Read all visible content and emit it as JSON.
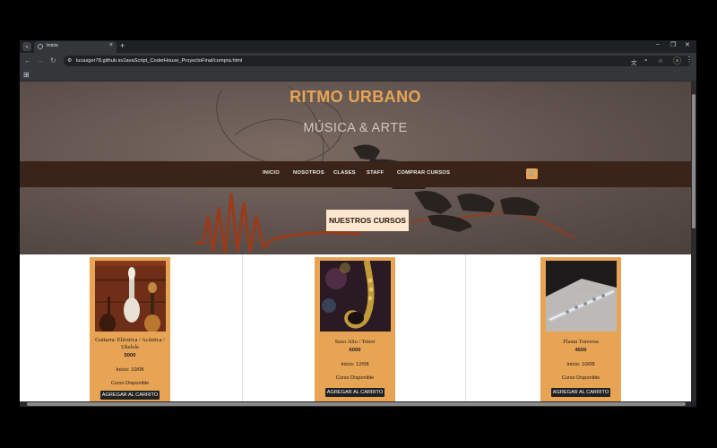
{
  "browser": {
    "tab_title": "Inicio",
    "url": "lucasger78.github.io/JavaScript_CoderHouse_ProyectoFinal/compra.html",
    "profile_initial": "a"
  },
  "site": {
    "brand": "RITMO URBANO",
    "tagline": "MÚSICA & ARTE",
    "nav": [
      "INICIO",
      "NOSOTROS",
      "CLASES",
      "STAFF",
      "COMPRAR CURSOS"
    ],
    "section_button": "NUESTROS CURSOS"
  },
  "products": [
    {
      "name": "Guitarra: Eléctrica / Acústica / Ukelele",
      "price": "5000",
      "start": "Inicio: 10/08",
      "status": "Curso Disponible",
      "button": "AGREGAR AL CARRITO",
      "image_icon": "guitar-icon"
    },
    {
      "name": "Saxo Alto / Tenor",
      "price": "6000",
      "start": "Inicio: 12/08",
      "status": "Curso Disponible",
      "button": "AGREGAR AL CARRITO",
      "image_icon": "saxophone-icon"
    },
    {
      "name": "Flauta Traversa",
      "price": "4500",
      "start": "Inicio: 10/08",
      "status": "Curso Disponible",
      "button": "AGREGAR AL CARRITO",
      "image_icon": "flute-icon"
    }
  ],
  "colors": {
    "accent": "#e8a455",
    "navbar": "#3a241a",
    "section_button_bg": "#fde7cf"
  }
}
